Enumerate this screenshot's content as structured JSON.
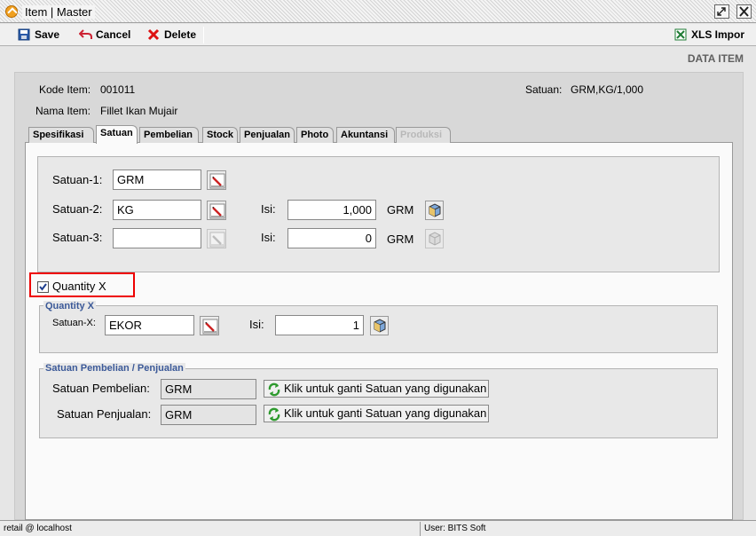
{
  "window": {
    "title": "Item | Master"
  },
  "toolbar": {
    "save": "Save",
    "cancel": "Cancel",
    "delete": "Delete",
    "xls_import": "XLS Impor"
  },
  "header": {
    "section_label": "DATA ITEM"
  },
  "item": {
    "kode_label": "Kode Item:",
    "kode_value": "001011",
    "nama_label": "Nama Item:",
    "nama_value": "Fillet Ikan Mujair",
    "satuan_label": "Satuan:",
    "satuan_value": "GRM,KG/1,000"
  },
  "tabs": [
    {
      "label": "Spesifikasi"
    },
    {
      "label": "Satuan"
    },
    {
      "label": "Pembelian"
    },
    {
      "label": "Stock"
    },
    {
      "label": "Penjualan"
    },
    {
      "label": "Photo"
    },
    {
      "label": "Akuntansi"
    },
    {
      "label": "Produksi"
    }
  ],
  "satuan": {
    "s1_label": "Satuan-1:",
    "s1_value": "GRM",
    "s2_label": "Satuan-2:",
    "s2_value": "KG",
    "s2_isi_label": "Isi:",
    "s2_isi_value": "1,000",
    "s2_unit": "GRM",
    "s3_label": "Satuan-3:",
    "s3_value": "",
    "s3_isi_label": "Isi:",
    "s3_isi_value": "0",
    "s3_unit": "GRM"
  },
  "quantity_x": {
    "checkbox_label": "Quantity X",
    "checked": true,
    "group_title": "Quantity X",
    "satuan_label": "Satuan-X:",
    "satuan_value": "EKOR",
    "isi_label": "Isi:",
    "isi_value": "1"
  },
  "pembelian_penjualan": {
    "group_title": "Satuan Pembelian / Penjualan",
    "pembelian_label": "Satuan Pembelian:",
    "pembelian_value": "GRM",
    "penjualan_label": "Satuan Penjualan:",
    "penjualan_value": "GRM",
    "swap_button": "Klik untuk ganti Satuan yang digunakan"
  },
  "status": {
    "connection": "retail @ localhost",
    "user": "User: BITS Soft"
  },
  "colors": {
    "legend_blue": "#3b5998",
    "highlight_red": "#e00000"
  }
}
